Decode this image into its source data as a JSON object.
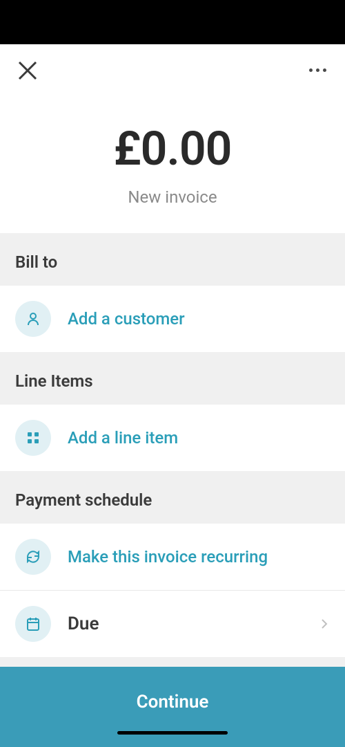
{
  "amount": "£0.00",
  "subtitle": "New invoice",
  "sections": {
    "billTo": {
      "header": "Bill to",
      "addCustomer": "Add a customer"
    },
    "lineItems": {
      "header": "Line Items",
      "addLineItem": "Add a line item"
    },
    "paymentSchedule": {
      "header": "Payment schedule",
      "recurring": "Make this invoice recurring",
      "due": "Due"
    }
  },
  "continueButton": "Continue"
}
